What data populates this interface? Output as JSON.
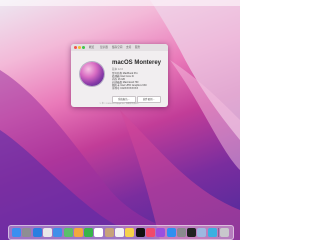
{
  "window": {
    "tabs": [
      "概览",
      "显示器",
      "储存空间",
      "支持",
      "服务"
    ],
    "os_name": "macOS Monterey",
    "os_version": "版本 12.6",
    "specs": [
      "型号名称  MacBook Pro",
      "处理器  Intel Core i9",
      "内存  16 GB",
      "启动磁盘  Macintosh HD",
      "图形卡  Intel UHD Graphics 630",
      "序列号  C02XXXXXXXX"
    ],
    "buttons": [
      "系统报告…",
      "软件更新…"
    ],
    "footer": "™ 和 © 1983-2022 Apple Inc. 保留所有权利。"
  },
  "dock": {
    "icons": [
      {
        "name": "finder-icon",
        "color": "#3a8ff0"
      },
      {
        "name": "launchpad-icon",
        "color": "#8e8e93"
      },
      {
        "name": "safari-icon",
        "color": "#2a7fe0"
      },
      {
        "name": "chrome-icon",
        "color": "#e8e8e8"
      },
      {
        "name": "mail-icon",
        "color": "#3f8fe8"
      },
      {
        "name": "maps-icon",
        "color": "#5bbf6a"
      },
      {
        "name": "photos-icon",
        "color": "#f2a83c"
      },
      {
        "name": "facetime-icon",
        "color": "#38b44a"
      },
      {
        "name": "calendar-icon",
        "color": "#ffffff"
      },
      {
        "name": "contacts-icon",
        "color": "#c7a27a"
      },
      {
        "name": "reminders-icon",
        "color": "#f2f2f2"
      },
      {
        "name": "notes-icon",
        "color": "#f6d24a"
      },
      {
        "name": "tv-icon",
        "color": "#111111"
      },
      {
        "name": "music-icon",
        "color": "#f04a6a"
      },
      {
        "name": "podcasts-icon",
        "color": "#9b4fe0"
      },
      {
        "name": "appstore-icon",
        "color": "#2f8ff0"
      },
      {
        "name": "settings-icon",
        "color": "#8a8a8e"
      },
      {
        "name": "terminal-icon",
        "color": "#222222"
      },
      {
        "name": "preview-icon",
        "color": "#9db8e0"
      },
      {
        "name": "app-icon",
        "color": "#3ab0e0"
      },
      {
        "name": "trash-icon",
        "color": "#c8c8cc"
      }
    ]
  }
}
